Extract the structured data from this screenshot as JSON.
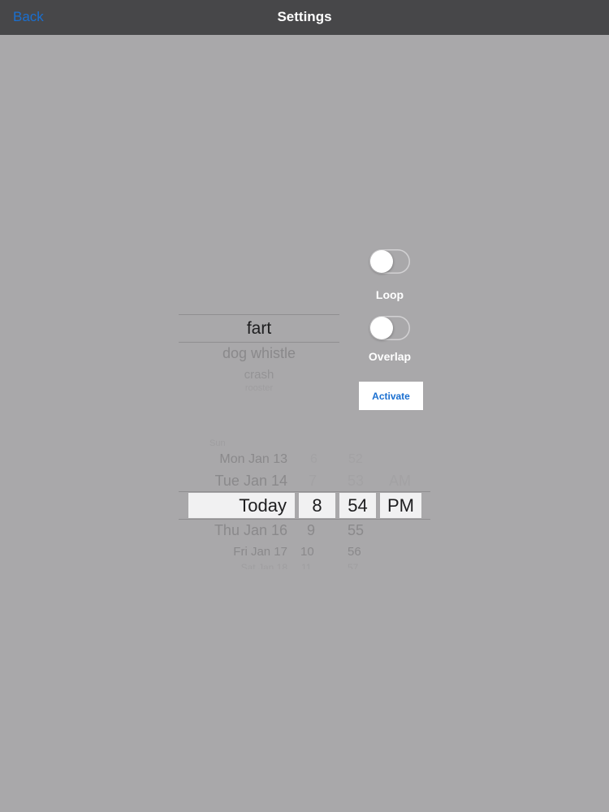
{
  "nav": {
    "back_label": "Back",
    "title": "Settings"
  },
  "toggles": {
    "loop": {
      "label": "Loop",
      "on": false
    },
    "overlap": {
      "label": "Overlap",
      "on": false
    }
  },
  "activate_label": "Activate",
  "sound_picker": {
    "selected": "fart",
    "below": [
      "dog whistle",
      "crash",
      "rooster"
    ]
  },
  "date_picker": {
    "day": {
      "above": [
        "Sun",
        "Mon Jan 13",
        "Tue Jan 14"
      ],
      "selected": "Today",
      "below": [
        "Thu Jan 16",
        "Fri Jan 17",
        "Sat Jan 18"
      ]
    },
    "hour": {
      "above": [
        "6",
        "7"
      ],
      "selected": "8",
      "below": [
        "9",
        "10",
        "11"
      ]
    },
    "minute": {
      "above": [
        "52",
        "53"
      ],
      "selected": "54",
      "below": [
        "55",
        "56",
        "57"
      ]
    },
    "ampm": {
      "above": [
        "AM"
      ],
      "selected": "PM"
    }
  },
  "colors": {
    "background": "#a9a8aa",
    "navbar": "#474749",
    "accent": "#1a6fd0"
  }
}
